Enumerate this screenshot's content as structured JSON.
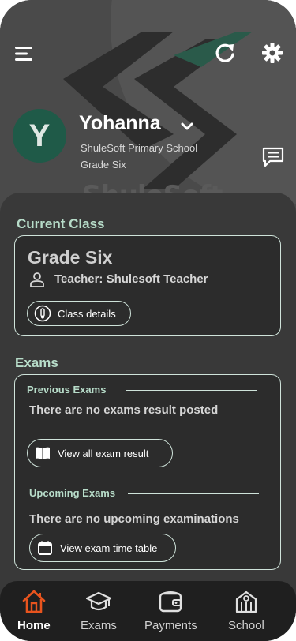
{
  "header": {
    "menu_icon": "menu-icon",
    "refresh_icon": "refresh-icon",
    "settings_icon": "gear-icon",
    "logo_text": "ShuleSoft"
  },
  "profile": {
    "avatar_letter": "Y",
    "name": "Yohanna",
    "school": "ShuleSoft Primary School",
    "grade": "Grade Six",
    "message_icon": "message-icon"
  },
  "current_class": {
    "section_title": "Current Class",
    "class_name": "Grade Six",
    "teacher": "Teacher: Shulesoft Teacher",
    "details_button": "Class details"
  },
  "exams": {
    "section_title": "Exams",
    "previous_title": "Previous Exams",
    "previous_empty": "There are no exams result posted",
    "view_results_button": "View all exam result",
    "upcoming_title": "Upcoming Exams",
    "upcoming_empty": "There are no upcoming examinations",
    "timetable_button": "View exam time table"
  },
  "nav": {
    "items": [
      {
        "label": "Home",
        "icon": "home-icon",
        "active": true
      },
      {
        "label": "Exams",
        "icon": "graduation-cap-icon",
        "active": false
      },
      {
        "label": "Payments",
        "icon": "wallet-icon",
        "active": false
      },
      {
        "label": "School",
        "icon": "school-icon",
        "active": false
      }
    ]
  },
  "colors": {
    "accent": "#b7dcc9",
    "avatar_bg": "#1f5a48",
    "home_active": "#e8541e"
  }
}
